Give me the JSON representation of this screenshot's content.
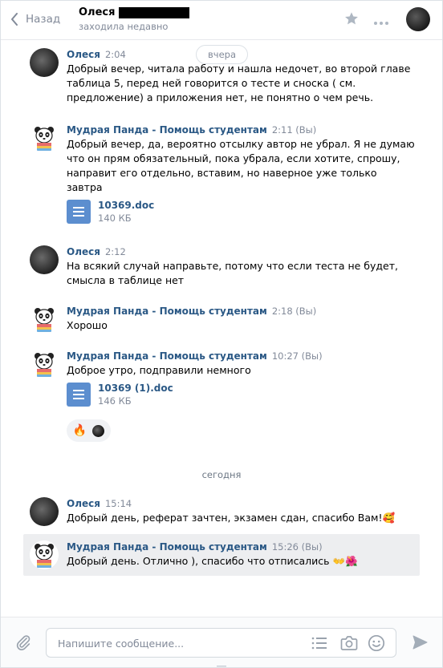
{
  "header": {
    "back_label": "Назад",
    "peer_name": "Олеся",
    "peer_status": "заходила недавно"
  },
  "dates": {
    "yesterday": "вчера",
    "today": "сегодня"
  },
  "messages": [
    {
      "author": "Олеся",
      "time": "2:04",
      "text": "Добрый вечер, читала работу и нашла недочет, во второй главе таблица 5, перед ней говорится о тесте и сноска ( см. предложение) а приложения нет, не понятно о чем речь."
    },
    {
      "author": "Мудрая Панда - Помощь студентам",
      "time": "2:11 (Вы)",
      "text": "Добрый вечер, да, вероятно отсылку автор не убрал. Я не думаю что он прям обязательный, пока убрала, если хотите, спрошу, направит его отдельно, вставим, но наверное уже только завтра",
      "doc": {
        "name": "10369.doc",
        "size": "140 КБ"
      }
    },
    {
      "author": "Олеся",
      "time": "2:12",
      "text": "На всякий случай направьте, потому что если теста не будет, смысла в таблице нет"
    },
    {
      "author": "Мудрая Панда - Помощь студентам",
      "time": "2:18 (Вы)",
      "text": "Хорошо"
    },
    {
      "author": "Мудрая Панда - Помощь студентам",
      "time": "10:27 (Вы)",
      "text": "Доброе утро, подправили немного",
      "doc": {
        "name": "10369 (1).doc",
        "size": "146 КБ"
      },
      "reactions": [
        "🔥",
        "avatar"
      ]
    },
    {
      "author": "Олеся",
      "time": "15:14",
      "text": "Добрый день, реферат зачтен, экзамен сдан, спасибо Вам!🥰"
    },
    {
      "author": "Мудрая Панда - Помощь студентам",
      "time": "15:26 (Вы)",
      "text": "Добрый день. Отлично ), спасибо что отписались 👐🌺"
    }
  ],
  "composer": {
    "placeholder": "Напишите сообщение..."
  },
  "colors": {
    "link": "#2a5885",
    "muted": "#828a99",
    "doc_icon": "#5c8ecf",
    "send": "#a3adb8"
  },
  "icons": [
    "chevron-left-icon",
    "star-icon",
    "more-icon",
    "paperclip-icon",
    "template-list-icon",
    "camera-icon",
    "smile-icon",
    "send-icon",
    "document-icon"
  ]
}
